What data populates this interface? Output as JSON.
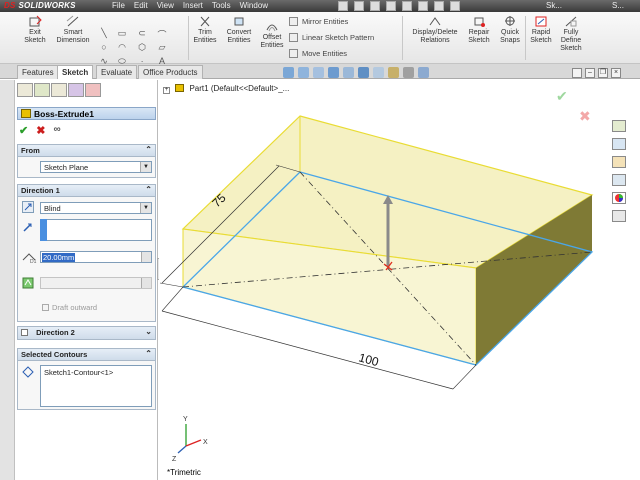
{
  "app": {
    "logo_prefix": "DS",
    "logo_text": "SOLIDWORKS",
    "menu": [
      "File",
      "Edit",
      "View",
      "Insert",
      "Tools",
      "Window"
    ],
    "title_short": "Sk...",
    "title_right": "S..."
  },
  "ribbon": {
    "exit_sketch": "Exit\nSketch",
    "smart_dimension": "Smart\nDimension",
    "trim_entities": "Trim\nEntities",
    "convert_entities": "Convert\nEntities",
    "offset_entities": "Offset\nEntities",
    "mirror_entities": "Mirror Entities",
    "linear_sketch_pattern": "Linear Sketch Pattern",
    "move_entities": "Move Entities",
    "display_delete_relations": "Display/Delete\nRelations",
    "repair_sketch": "Repair\nSketch",
    "quick_snaps": "Quick\nSnaps",
    "rapid_sketch": "Rapid\nSketch",
    "fully_define_sketch": "Fully\nDefine\nSketch"
  },
  "tabs": [
    "Features",
    "Sketch",
    "Evaluate",
    "Office Products"
  ],
  "active_tab": "Sketch",
  "property_manager": {
    "title": "Boss-Extrude1",
    "from": {
      "header": "From",
      "value": "Sketch Plane"
    },
    "direction1": {
      "header": "Direction 1",
      "end_condition": "Blind",
      "depth": "20.00mm",
      "draft_outward_label": "Draft outward"
    },
    "direction2": {
      "header": "Direction 2"
    },
    "selected_contours": {
      "header": "Selected Contours",
      "items": [
        "Sketch1-Contour<1>"
      ]
    }
  },
  "tree": {
    "root": "Part1 (Default<<Default>_..."
  },
  "graphics": {
    "dim_width": "100",
    "dim_depth": "75",
    "view_name": "*Trimetric",
    "axis_x": "X",
    "axis_y": "Y",
    "axis_z": "Z"
  },
  "colors": {
    "accent_blue": "#316ac5",
    "preview_fill": "#f5f0a8",
    "sketch_blue": "#4aa6e8",
    "edge_yellow": "#e9dc34",
    "ok_green": "#2b9e2b",
    "cancel_red": "#cc1d1d"
  }
}
